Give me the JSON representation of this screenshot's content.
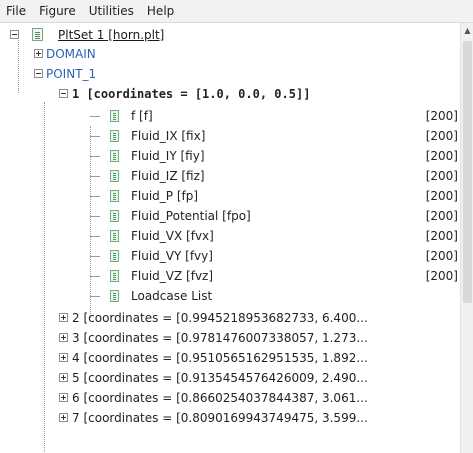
{
  "menu": [
    "File",
    "Figure",
    "Utilities",
    "Help"
  ],
  "tree": {
    "root": "PltSet 1 [horn.plt]",
    "domain": "DOMAIN",
    "point": "POINT_1",
    "coord1": "1 [coordinates = [1.0, 0.0, 0.5]]",
    "leaves": [
      {
        "label": "f  [f]",
        "value": "[200]"
      },
      {
        "label": "Fluid_IX  [fix]",
        "value": "[200]"
      },
      {
        "label": "Fluid_IY  [fiy]",
        "value": "[200]"
      },
      {
        "label": "Fluid_IZ  [fiz]",
        "value": "[200]"
      },
      {
        "label": "Fluid_P  [fp]",
        "value": "[200]"
      },
      {
        "label": "Fluid_Potential  [fpo]",
        "value": "[200]"
      },
      {
        "label": "Fluid_VX  [fvx]",
        "value": "[200]"
      },
      {
        "label": "Fluid_VY  [fvy]",
        "value": "[200]"
      },
      {
        "label": "Fluid_VZ  [fvz]",
        "value": "[200]"
      },
      {
        "label": "Loadcase List",
        "value": ""
      }
    ],
    "collapsed": [
      "2 [coordinates = [0.9945218953682733, 6.400...",
      "3 [coordinates = [0.9781476007338057, 1.273...",
      "4 [coordinates = [0.9510565162951535, 1.892...",
      "5 [coordinates = [0.9135454576426009, 2.490...",
      "6 [coordinates = [0.8660254037844387, 3.061...",
      "7 [coordinates = [0.8090169943749475, 3.599..."
    ]
  }
}
